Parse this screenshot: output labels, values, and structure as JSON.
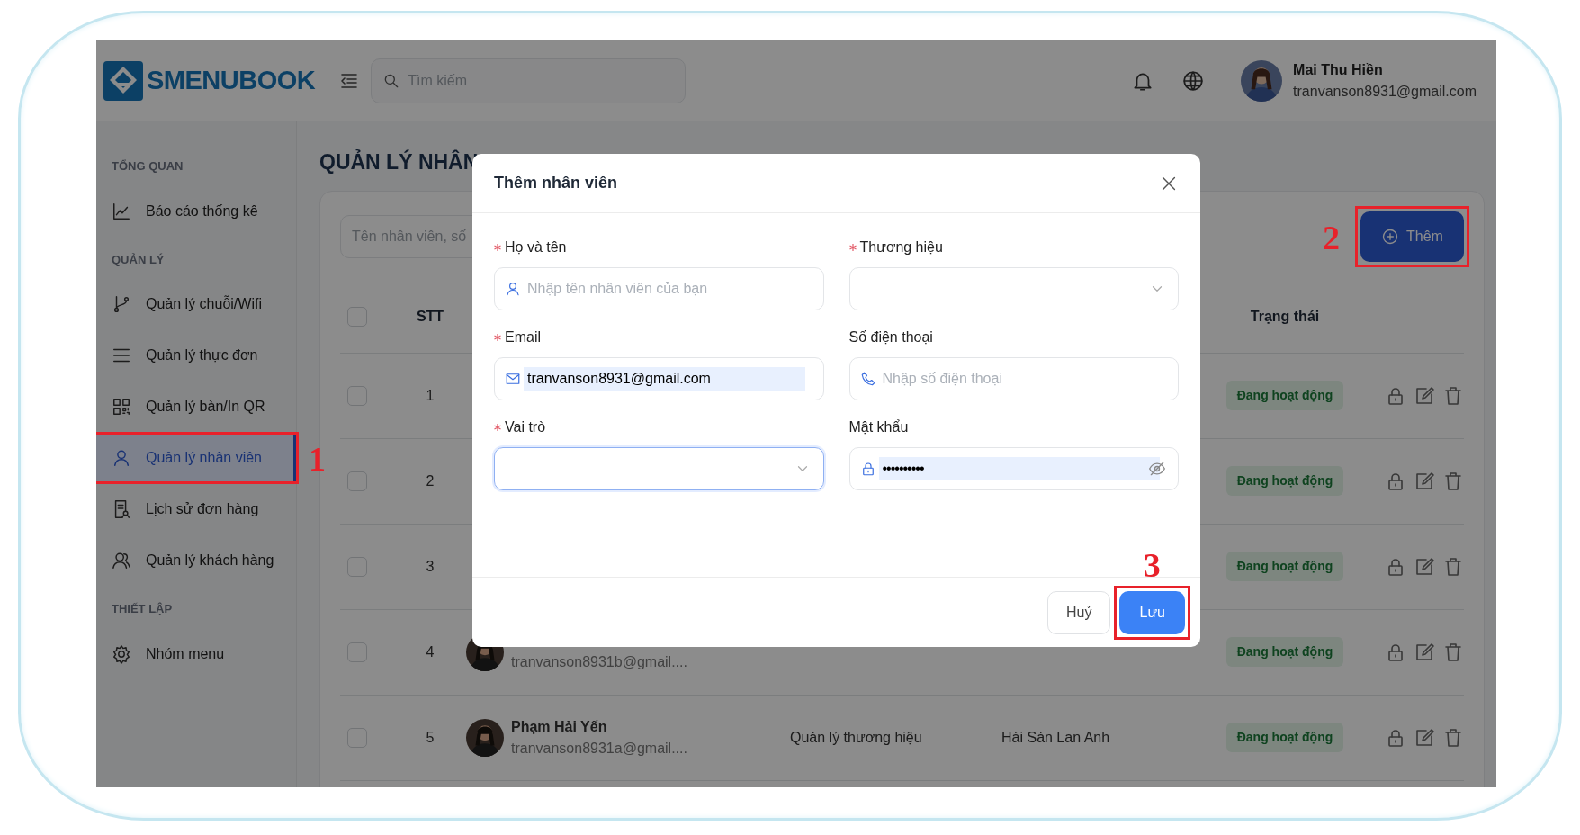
{
  "header": {
    "logo": "SMENUBOOK",
    "search": {
      "placeholder": "Tìm kiếm"
    },
    "user": {
      "name": "Mai Thu Hiền",
      "email": "tranvanson8931@gmail.com"
    }
  },
  "sidebar": {
    "sections": [
      {
        "title": "TỔNG QUAN",
        "items": [
          {
            "label": "Báo cáo thống kê",
            "selected": false
          }
        ]
      },
      {
        "title": "QUẢN LÝ",
        "items": [
          {
            "label": "Quản lý chuỗi/Wifi",
            "selected": false
          },
          {
            "label": "Quản lý thực đơn",
            "selected": false
          },
          {
            "label": "Quản lý bàn/In QR",
            "selected": false
          },
          {
            "label": "Quản lý nhân viên",
            "selected": true
          },
          {
            "label": "Lịch sử đơn hàng",
            "selected": false
          },
          {
            "label": "Quản lý khách hàng",
            "selected": false
          }
        ]
      },
      {
        "title": "THIẾT LẬP",
        "items": [
          {
            "label": "Nhóm menu",
            "selected": false
          }
        ]
      }
    ]
  },
  "page": {
    "title": "QUẢN LÝ NHÂN",
    "search": {
      "placeholder": "Tên nhân viên, số"
    },
    "add_button": "Thêm"
  },
  "table": {
    "select_all_checked": false,
    "columns": {
      "stt": "STT",
      "status": "Trạng thái"
    },
    "rows": [
      {
        "stt": "1",
        "status": "Đang hoạt động",
        "checked": false
      },
      {
        "stt": "2",
        "status": "Đang hoạt động",
        "checked": false
      },
      {
        "stt": "3",
        "status": "Đang hoạt động",
        "checked": false
      },
      {
        "stt": "4",
        "email": "tranvanson8931b@gmail....",
        "status": "Đang hoạt động",
        "checked": false
      },
      {
        "stt": "5",
        "name": "Phạm Hải Yến",
        "email": "tranvanson8931a@gmail....",
        "role": "Quản lý thương hiệu",
        "brand": "Hải Sản Lan Anh",
        "status": "Đang hoạt động",
        "checked": false
      }
    ]
  },
  "modal": {
    "title": "Thêm nhân viên",
    "fields": [
      {
        "label": "Họ và tên",
        "required": true,
        "kind": "text",
        "placeholder": "Nhập tên nhân viên của bạn"
      },
      {
        "label": "Thương hiệu",
        "required": true,
        "kind": "select",
        "focused": false
      },
      {
        "label": "Email",
        "required": true,
        "kind": "text",
        "value": "tranvanson8931@gmail.com"
      },
      {
        "label": "Số điện thoại",
        "required": false,
        "kind": "text",
        "placeholder": "Nhập số điện thoại"
      },
      {
        "label": "Vai trò",
        "required": true,
        "kind": "select",
        "focused": true
      },
      {
        "label": "Mật khẩu",
        "required": false,
        "kind": "password",
        "value": "••••••••••"
      }
    ],
    "buttons": [
      {
        "label": "Huỷ",
        "kind": "secondary"
      },
      {
        "label": "Lưu",
        "kind": "primary"
      }
    ]
  },
  "annotations": [
    {
      "label": "1"
    },
    {
      "label": "2"
    },
    {
      "label": "3"
    }
  ]
}
